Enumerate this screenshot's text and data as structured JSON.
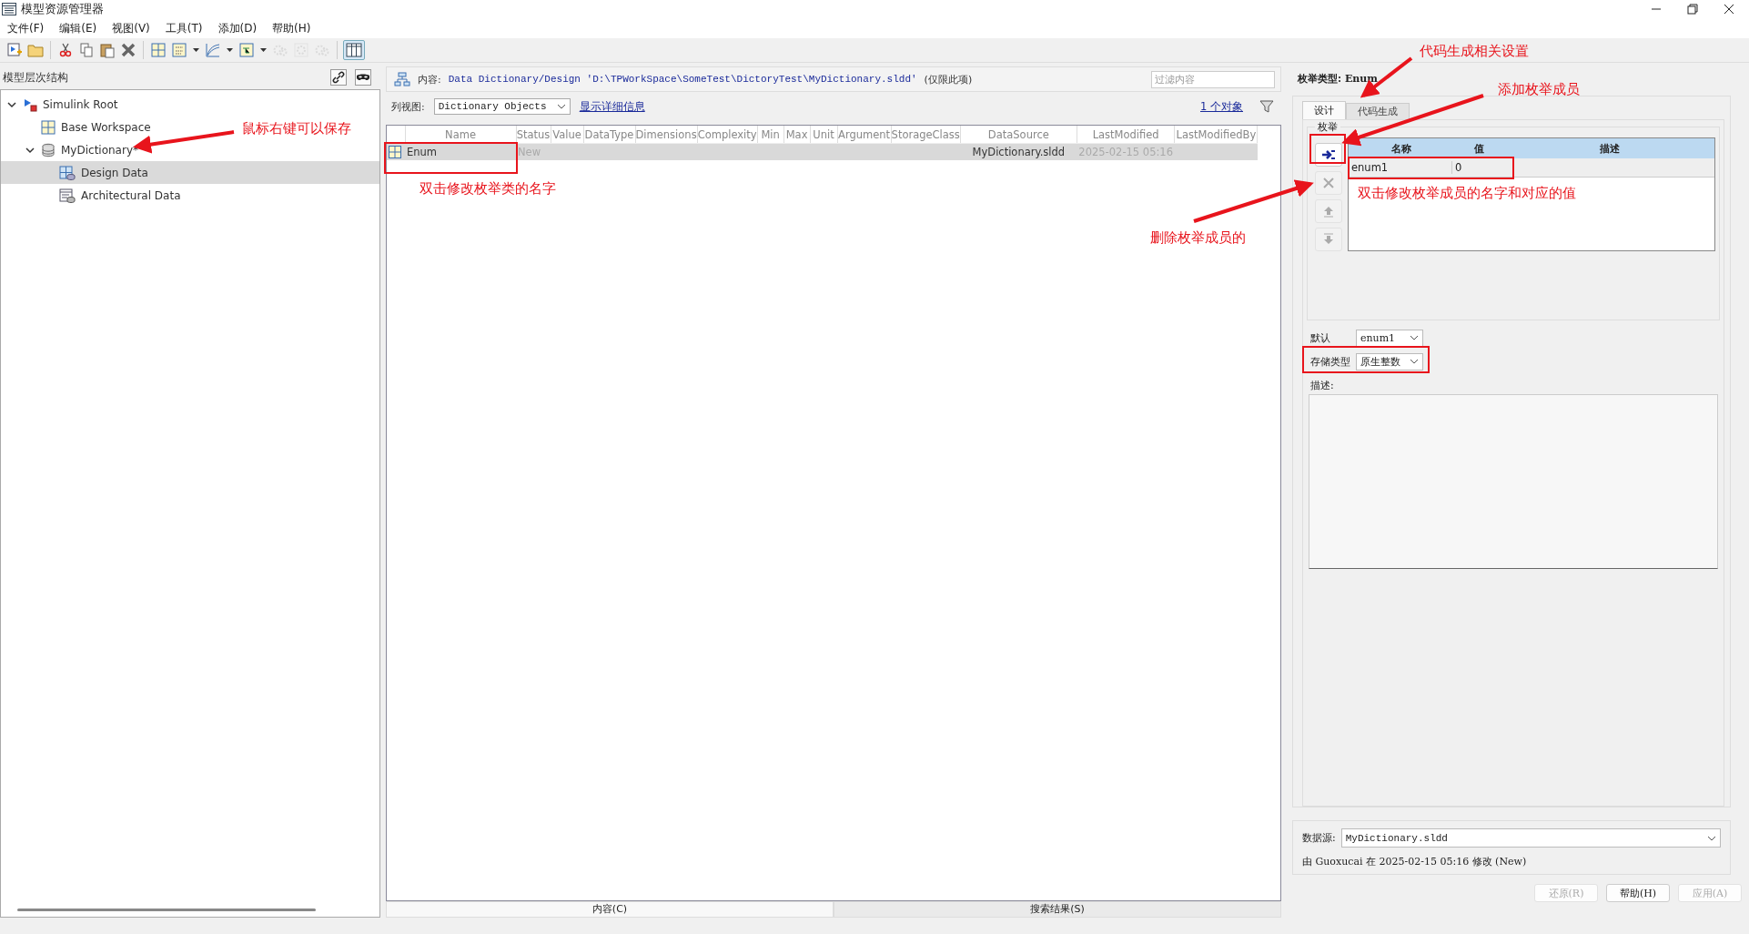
{
  "window": {
    "title": "模型资源管理器"
  },
  "menu": [
    "文件(F)",
    "编辑(E)",
    "视图(V)",
    "工具(T)",
    "添加(D)",
    "帮助(H)"
  ],
  "toolbar": [
    {
      "kind": "new",
      "disabled": false
    },
    {
      "kind": "open",
      "disabled": false
    },
    {
      "kind": "sep"
    },
    {
      "kind": "cut",
      "disabled": false
    },
    {
      "kind": "copy",
      "disabled": false
    },
    {
      "kind": "paste",
      "disabled": false
    },
    {
      "kind": "delete",
      "disabled": false
    },
    {
      "kind": "sep"
    },
    {
      "kind": "grid",
      "disabled": false
    },
    {
      "kind": "binary",
      "disabled": false
    },
    {
      "kind": "caret",
      "disabled": false
    },
    {
      "kind": "curve",
      "disabled": false
    },
    {
      "kind": "caret",
      "disabled": false
    },
    {
      "kind": "block",
      "disabled": false
    },
    {
      "kind": "caret",
      "disabled": false
    },
    {
      "kind": "gears",
      "disabled": true
    },
    {
      "kind": "gear",
      "disabled": true
    },
    {
      "kind": "gears",
      "disabled": true
    },
    {
      "kind": "sep"
    },
    {
      "kind": "columns",
      "disabled": false
    }
  ],
  "hierarchy": {
    "title": "模型层次结构",
    "tree": [
      {
        "label": "Simulink Root",
        "kind": "root",
        "expanded": true,
        "selected": false,
        "children": [
          {
            "label": "Base Workspace",
            "kind": "workspace",
            "selected": false
          },
          {
            "label": "MyDictionary*",
            "kind": "dictionary",
            "expanded": true,
            "selected": false,
            "children": [
              {
                "label": "Design Data",
                "kind": "design",
                "selected": true
              },
              {
                "label": "Architectural Data",
                "kind": "arch",
                "selected": false
              }
            ]
          }
        ]
      }
    ]
  },
  "contents": {
    "label": "内容:",
    "path": "Data Dictionary/Design 'D:\\TPWorkSpace\\SomeTest\\DictoryTest\\MyDictionary.sldd'",
    "scope": "(仅限此项)",
    "filter_placeholder": "过滤内容",
    "view_label": "列视图:",
    "view_value": "Dictionary Objects",
    "details_link": "显示详细信息",
    "count": "1 个对象",
    "columns": [
      "Name",
      "Status",
      "Value",
      "DataType",
      "Dimensions",
      "Complexity",
      "Min",
      "Max",
      "Unit",
      "Argument",
      "StorageClass",
      "DataSource",
      "LastModified",
      "LastModifiedBy"
    ],
    "rows": [
      {
        "name": "Enum",
        "status": "New",
        "data_source": "MyDictionary.sldd",
        "last_modified": "2025-02-15 05:16",
        "selected": true
      }
    ],
    "bottom_tabs": [
      {
        "label": "内容(C)",
        "selected": true
      },
      {
        "label": "搜索结果(S)",
        "selected": false
      }
    ]
  },
  "enum_panel": {
    "heading": "枚举类型: Enum",
    "tabs": [
      {
        "label": "设计",
        "selected": true
      },
      {
        "label": "代码生成",
        "selected": false
      }
    ],
    "group": "枚举",
    "member_buttons": [
      {
        "kind": "add",
        "disabled": false
      },
      {
        "kind": "remove",
        "disabled": true
      },
      {
        "kind": "up",
        "disabled": true
      },
      {
        "kind": "down",
        "disabled": true
      }
    ],
    "member_columns": [
      "名称",
      "值",
      "描述"
    ],
    "members": [
      {
        "name": "enum1",
        "value": "0",
        "selected": true
      }
    ],
    "default_label": "默认",
    "default_value": "enum1",
    "storage_label": "存储类型",
    "storage_value": "原生整数",
    "description_label": "描述:",
    "datasource_label": "数据源:",
    "datasource_value": "MyDictionary.sldd",
    "modified_note": "由 Guoxucai 在 2025-02-15 05:16 修改 (New)",
    "buttons": [
      {
        "label": "还原(R)",
        "disabled": true
      },
      {
        "label": "帮助(H)",
        "disabled": false
      },
      {
        "label": "应用(A)",
        "disabled": true
      }
    ]
  },
  "annotations": [
    {
      "text": "鼠标右键可以保存"
    },
    {
      "text": "双击修改枚举类的名字"
    },
    {
      "text": "代码生成相关设置"
    },
    {
      "text": "添加枚举成员"
    },
    {
      "text": "双击修改枚举成员的名字和对应的值"
    },
    {
      "text": "删除枚举成员的"
    }
  ]
}
